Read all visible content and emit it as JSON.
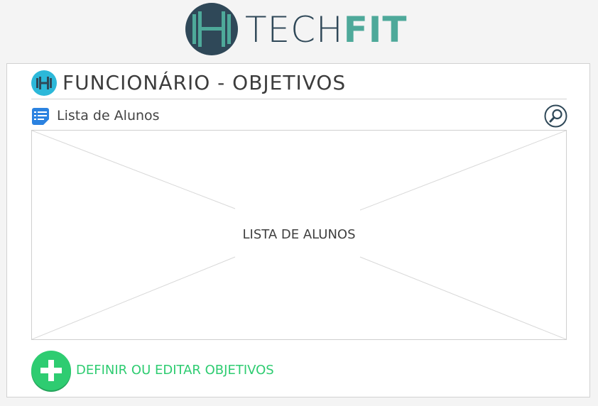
{
  "brand": {
    "logo_letter": "H",
    "name_part1": "TECH",
    "name_part2": "FIT",
    "primary_color": "#2f4858",
    "accent_color": "#4ea99a"
  },
  "page": {
    "title": "FUNCIONÁRIO - OBJETIVOS",
    "title_icon": "dumbbell-icon"
  },
  "list": {
    "label": "Lista de Alunos",
    "icon": "list-icon",
    "search_icon": "search-icon",
    "placeholder_text": "LISTA DE ALUNOS"
  },
  "actions": {
    "add_label": "DEFINIR OU EDITAR OBJETIVOS",
    "add_icon": "plus-icon",
    "add_color": "#2ecc71"
  }
}
